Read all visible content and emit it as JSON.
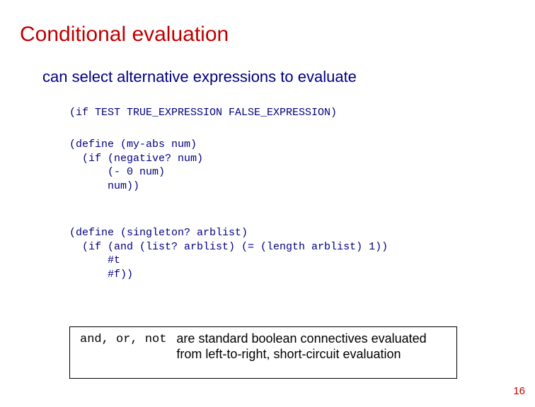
{
  "title": "Conditional evaluation",
  "subtitle": "can select alternative expressions to evaluate",
  "code_if": "(if TEST TRUE_EXPRESSION FALSE_EXPRESSION)",
  "code_myabs": "(define (my-abs num)\n  (if (negative? num)\n      (- 0 num)\n      num))",
  "code_singleton": "(define (singleton? arblist)\n  (if (and (list? arblist) (= (length arblist) 1))\n      #t\n      #f))",
  "box": {
    "ops": "and, or, not",
    "desc": "are standard boolean connectives evaluated from left-to-right, short-circuit evaluation"
  },
  "page_number": "16"
}
